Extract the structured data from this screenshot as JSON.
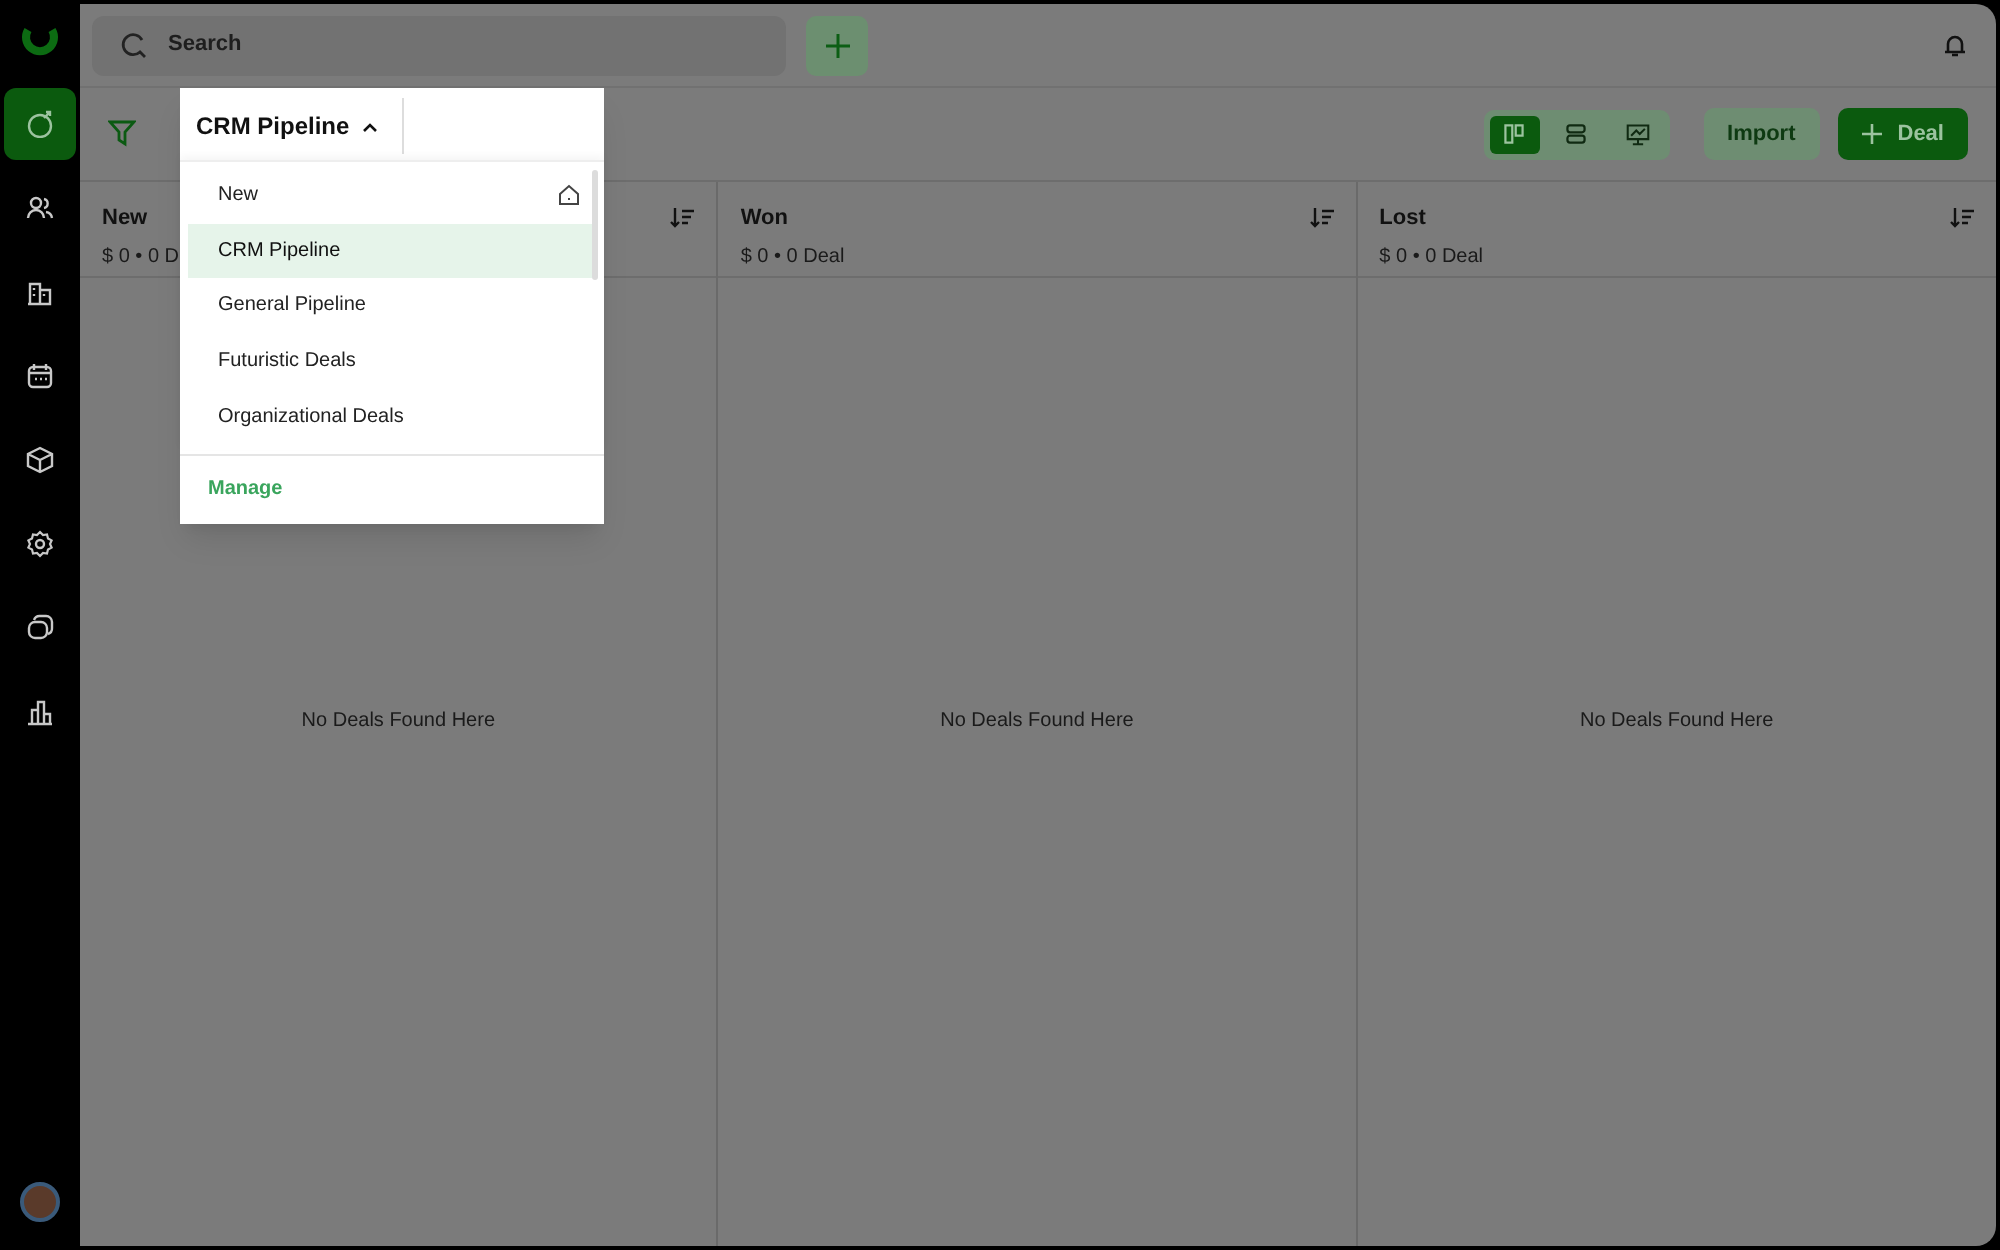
{
  "sidebar": {
    "items": [
      {
        "selected": true
      },
      {
        "selected": false
      },
      {
        "selected": false
      },
      {
        "selected": false
      },
      {
        "selected": false
      },
      {
        "selected": false
      },
      {
        "selected": false
      },
      {
        "selected": false
      }
    ]
  },
  "search": {
    "placeholder": "Search"
  },
  "pipeline_select": {
    "label": "CRM Pipeline",
    "expanded": true,
    "options": [
      {
        "label": "New",
        "selected": false,
        "default": true
      },
      {
        "label": "CRM Pipeline",
        "selected": true,
        "default": false
      },
      {
        "label": "General Pipeline",
        "selected": false,
        "default": false
      },
      {
        "label": "Futuristic Deals",
        "selected": false,
        "default": false
      },
      {
        "label": "Organizational Deals",
        "selected": false,
        "default": false
      }
    ],
    "footer": "Manage"
  },
  "view_toggle": [
    {
      "selected": true
    },
    {
      "selected": false
    },
    {
      "selected": false
    }
  ],
  "buttons": {
    "import": "Import",
    "add": "Deal"
  },
  "columns": [
    {
      "title": "New",
      "summary": "$ 0 • 0 D",
      "empty": "No Deals Found Here"
    },
    {
      "title": "Won",
      "summary": "$ 0 • 0 Deal",
      "empty": "No Deals Found Here"
    },
    {
      "title": "Lost",
      "summary": "$ 0 • 0 Deal",
      "empty": "No Deals Found Here"
    }
  ]
}
